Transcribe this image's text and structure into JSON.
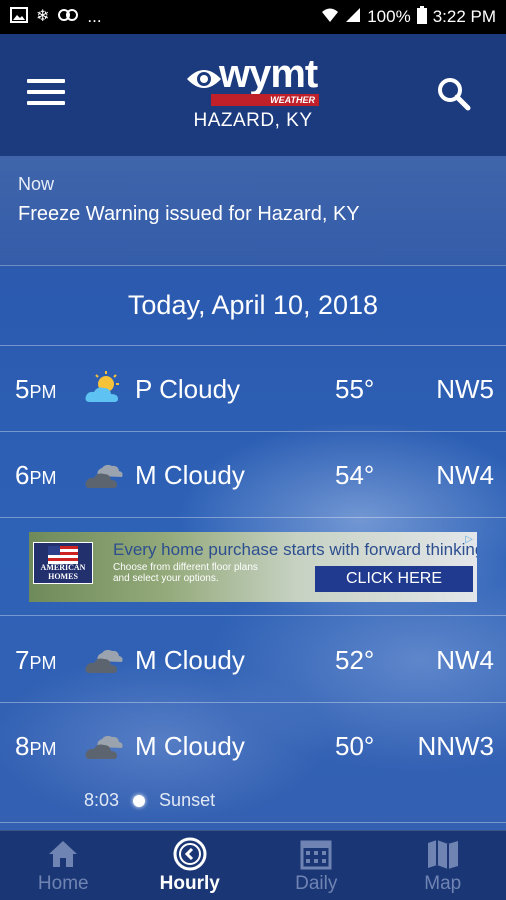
{
  "status_bar": {
    "left_icons": [
      "image-icon",
      "snowflake-icon",
      "sync-icon"
    ],
    "ellipsis": "...",
    "battery": "100%",
    "time": "3:22 PM"
  },
  "header": {
    "brand": "wymt",
    "brand_sub": "WEATHER",
    "location": "HAZARD, KY"
  },
  "alert": {
    "when": "Now",
    "message": "Freeze Warning issued for Hazard, KY"
  },
  "date": "Today, April 10, 2018",
  "hours": [
    {
      "hour": "5",
      "period": "PM",
      "icon": "partly-cloudy-icon",
      "condition": "P Cloudy",
      "temp": "55°",
      "wind": "NW5"
    },
    {
      "hour": "6",
      "period": "PM",
      "icon": "mostly-cloudy-icon",
      "condition": "M Cloudy",
      "temp": "54°",
      "wind": "NW4"
    },
    {
      "hour": "7",
      "period": "PM",
      "icon": "mostly-cloudy-icon",
      "condition": "M Cloudy",
      "temp": "52°",
      "wind": "NW4"
    },
    {
      "hour": "8",
      "period": "PM",
      "icon": "mostly-cloudy-icon",
      "condition": "M Cloudy",
      "temp": "50°",
      "wind": "NNW3"
    }
  ],
  "sunset": {
    "time": "8:03",
    "label": "Sunset"
  },
  "ad": {
    "logo_text_1": "AMERICAN",
    "logo_text_2": "HOMES",
    "headline": "Every home purchase starts with forward thinking.",
    "fine_1": "Choose from different floor plans",
    "fine_2": "and select your options.",
    "cta": "CLICK HERE"
  },
  "nav": [
    {
      "label": "Home",
      "icon": "home-icon",
      "active": false
    },
    {
      "label": "Hourly",
      "icon": "clock-icon",
      "active": true
    },
    {
      "label": "Daily",
      "icon": "calendar-icon",
      "active": false
    },
    {
      "label": "Map",
      "icon": "map-icon",
      "active": false
    }
  ],
  "colors": {
    "header_bg": "#1c3a7e",
    "nav_bg": "#1a3674",
    "nav_inactive": "#6f84b3",
    "brand_red": "#c0202a"
  }
}
